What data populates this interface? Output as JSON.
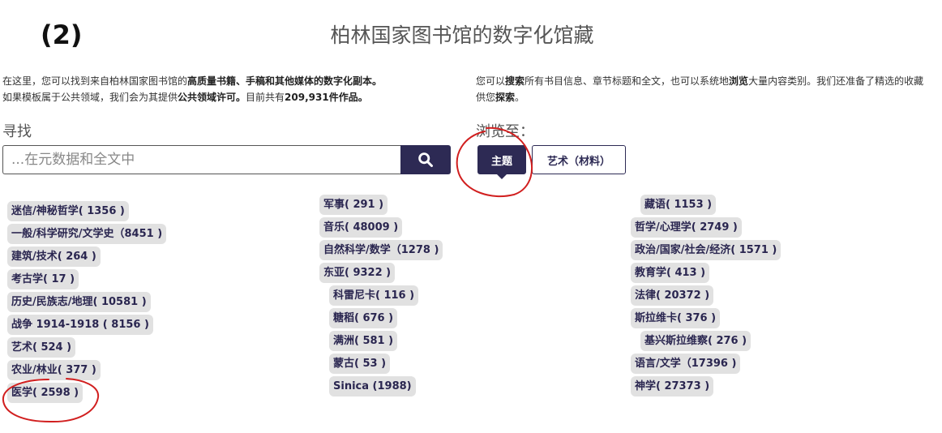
{
  "step_label": "(2)",
  "title": "柏林国家图书馆的数字化馆藏",
  "intro_left": {
    "line1_prefix": "在这里，您可以找到来自柏林国家图书馆的",
    "line1_bold": "高质量书籍、手稿和其他媒体的数字化副本。",
    "line2_prefix": "如果模板属于公共领域，我们会为其提供",
    "line2_bold1": "公共领域许可。",
    "line2_mid": "目前共有",
    "line2_bold2": "209,931件作品。"
  },
  "intro_right": {
    "p1": "您可以",
    "b1": "搜索",
    "p2": "所有书目信息、章节标题和全文，也可以系统地",
    "b2": "浏览",
    "p3": "大量内容类别。我们还准备了精选的收藏供您",
    "b3": "探索",
    "p4": "。"
  },
  "search": {
    "label": "寻找",
    "placeholder": "...在元数据和全文中",
    "button_icon": "search-icon"
  },
  "browse": {
    "label": "浏览至：",
    "subject_button": "主题",
    "art_button": "艺术（材料）"
  },
  "categories": {
    "col1": [
      "迷信/神秘哲学( 1356 )",
      "一般/科学研究/文学史（8451 )",
      "建筑/技术( 264 )",
      "考古学( 17 )",
      "历史/民族志/地理( 10581 )",
      "战争 1914-1918 ( 8156 )",
      "艺术( 524 )",
      "农业/林业( 377 )",
      "医学( 2598 )"
    ],
    "col2": [
      "军事( 291 )",
      "音乐( 48009 )",
      "自然科学/数学（1278 )",
      "东亚( 9322 )",
      "科雷尼卡( 116 )",
      "糖稻( 676 )",
      "满洲( 581 )",
      "蒙古( 53 )",
      "Sinica (1988)"
    ],
    "col3": [
      "藏语( 1153 )",
      "哲学/心理学( 2749 )",
      "政治/国家/社会/经济( 1571 )",
      "教育学( 413 )",
      "法律( 20372 )",
      "斯拉维卡( 376 )",
      "基兴斯拉维察( 276 )",
      "语言/文学（17396 )",
      "神学( 27373 )"
    ]
  },
  "colors": {
    "accent": "#2d2a54",
    "chip_bg": "#e1e1e1",
    "annotation": "#d11f1f"
  }
}
